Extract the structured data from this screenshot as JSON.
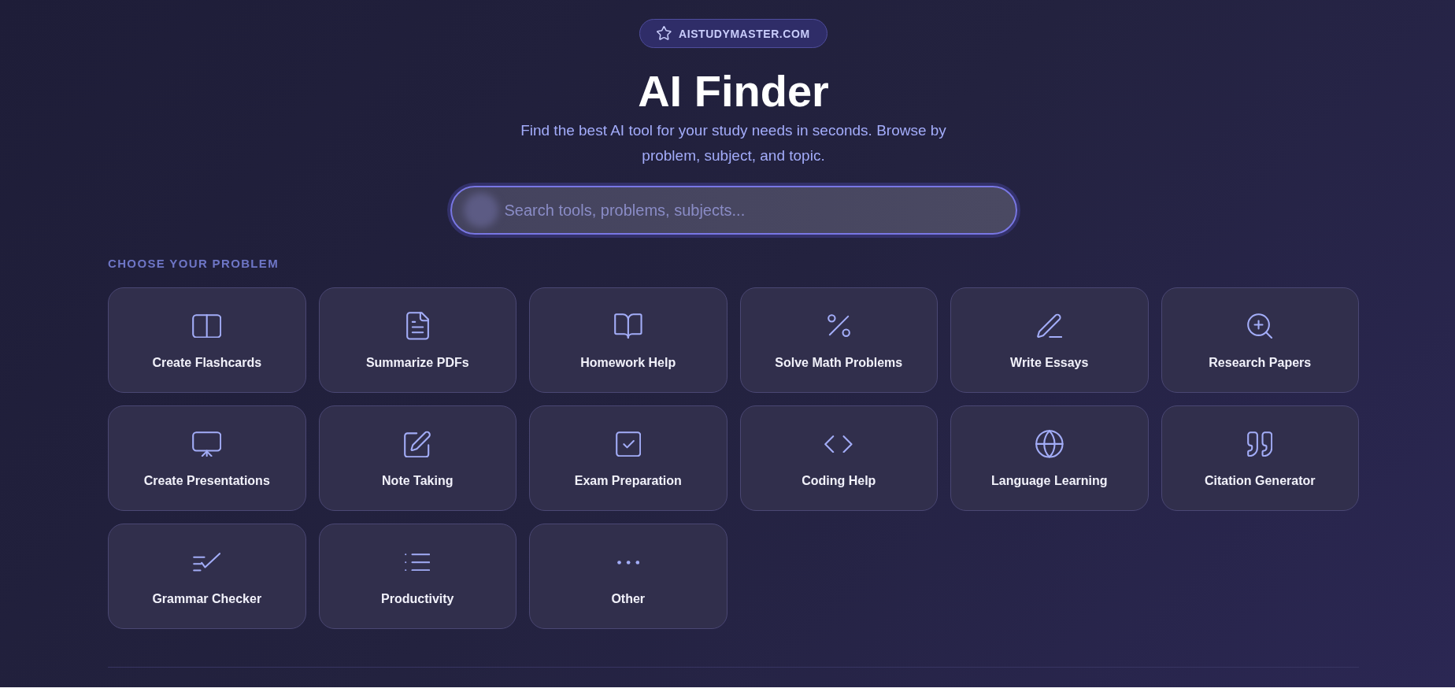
{
  "badge": {
    "label": "AISTUDYMASTER.COM"
  },
  "title": "AI Finder",
  "subtitle": "Find the best AI tool for your study needs in seconds. Browse by problem, subject, and topic.",
  "search": {
    "placeholder": "Search tools, problems, subjects..."
  },
  "problems": {
    "heading": "CHOOSE YOUR PROBLEM",
    "items": [
      {
        "label": "Create Flashcards"
      },
      {
        "label": "Summarize PDFs"
      },
      {
        "label": "Homework Help"
      },
      {
        "label": "Solve Math Problems"
      },
      {
        "label": "Write Essays"
      },
      {
        "label": "Research Papers"
      },
      {
        "label": "Create Presentations"
      },
      {
        "label": "Note Taking"
      },
      {
        "label": "Exam Preparation"
      },
      {
        "label": "Coding Help"
      },
      {
        "label": "Language Learning"
      },
      {
        "label": "Citation Generator"
      },
      {
        "label": "Grammar Checker"
      },
      {
        "label": "Productivity"
      },
      {
        "label": "Other"
      }
    ]
  }
}
